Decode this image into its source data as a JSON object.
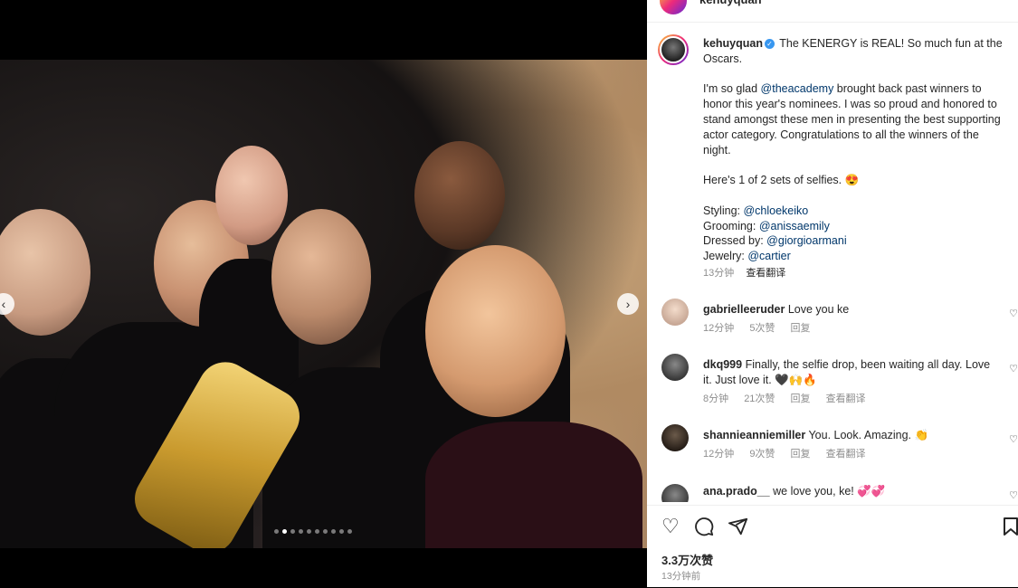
{
  "post": {
    "username": "kehuyquan",
    "caption_line1": "The KENERGY is REAL! So much fun at the Oscars.",
    "para2_pre": "I'm so glad ",
    "para2_mention": "@theacademy",
    "para2_post": " brought back past winners to honor this year's nominees. I was so proud and honored to stand amongst these men in presenting the best supporting actor category. Congratulations to all the winners of the night.",
    "para3": "Here's 1 of 2 sets of selfies. 😍",
    "credits": [
      {
        "label": "Styling: ",
        "handle": "@chloekeiko"
      },
      {
        "label": "Grooming: ",
        "handle": "@anissaemily"
      },
      {
        "label": "Dressed by: ",
        "handle": "@giorgioarmani"
      },
      {
        "label": "Jewelry: ",
        "handle": "@cartier"
      }
    ],
    "time": "13分钟",
    "translate": "查看翻译"
  },
  "comments": [
    {
      "user": "gabrielleeruder",
      "text": "Love you ke",
      "time": "12分钟",
      "likes": "5次赞",
      "reply": "回复",
      "translate": ""
    },
    {
      "user": "dkq999",
      "text": "Finally, the selfie drop, been waiting all day. Love it. Just love it. 🖤🙌🔥",
      "time": "8分钟",
      "likes": "21次赞",
      "reply": "回复",
      "translate": "查看翻译"
    },
    {
      "user": "shannieanniemiller",
      "text": "You. Look. Amazing. 👏",
      "time": "12分钟",
      "likes": "9次赞",
      "reply": "回复",
      "translate": "查看翻译"
    },
    {
      "user": "ana.prado__",
      "text": "we love you, ke! 💞💞"
    }
  ],
  "footer": {
    "likes": "3.3万次赞",
    "time": "13分钟前"
  },
  "icons": {
    "like": "heart-icon",
    "comment": "comment-icon",
    "share": "share-icon",
    "save": "bookmark-icon"
  },
  "carousel": {
    "count": 10,
    "active_index": 1
  }
}
